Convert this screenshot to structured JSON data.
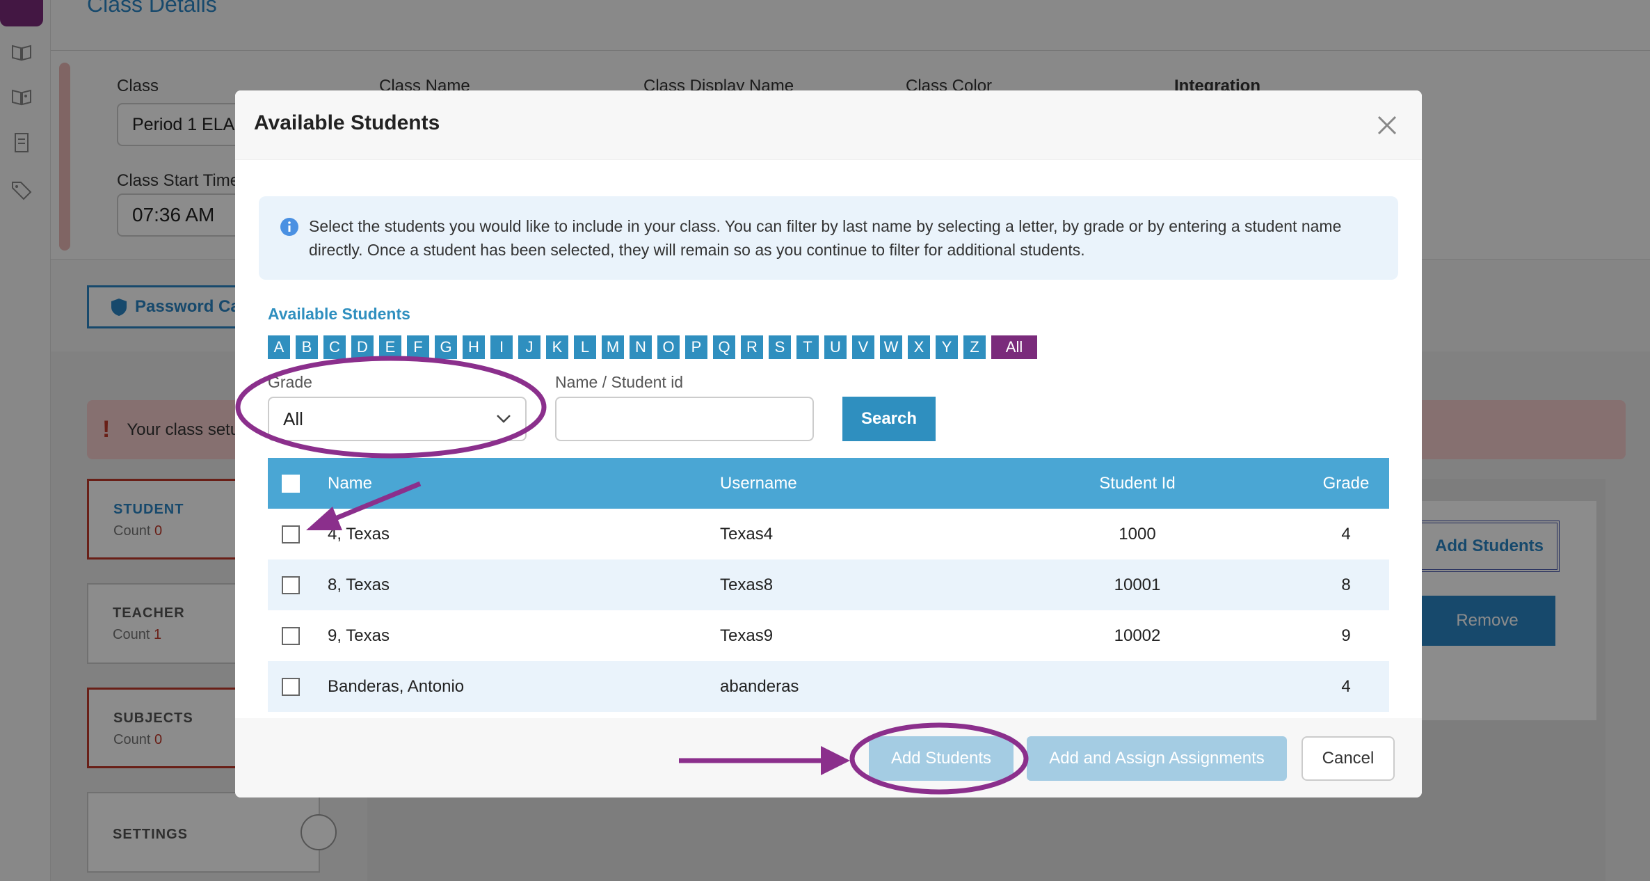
{
  "background": {
    "page_title": "Class Details",
    "fields": {
      "class_label": "Class",
      "class_value": "Period 1 ELA",
      "class_name_label": "Class Name",
      "display_name_label": "Class Display Name",
      "class_color_label": "Class Color",
      "integration_label": "Integration",
      "start_time_label": "Class Start Time",
      "start_time_value": "07:36 AM"
    },
    "password_button": "Password Ca",
    "alert_text": "Your class setu",
    "cards": [
      {
        "title": "STUDENT",
        "count_label": "Count",
        "count": "0"
      },
      {
        "title": "TEACHER",
        "count_label": "Count",
        "count": "1"
      },
      {
        "title": "SUBJECTS",
        "count_label": "Count",
        "count": "0"
      },
      {
        "title": "SETTINGS"
      }
    ],
    "add_students_button": "Add Students",
    "remove_button": "Remove"
  },
  "modal": {
    "title": "Available Students",
    "info_text": "Select the students you would like to include in your class. You can filter by last name by selecting a letter, by grade or by entering a student name directly. Once a student has been selected, they will remain so as you continue to filter for additional students.",
    "available_label": "Available Students",
    "letters": [
      "A",
      "B",
      "C",
      "D",
      "E",
      "F",
      "G",
      "H",
      "I",
      "J",
      "K",
      "L",
      "M",
      "N",
      "O",
      "P",
      "Q",
      "R",
      "S",
      "T",
      "U",
      "V",
      "W",
      "X",
      "Y",
      "Z"
    ],
    "all_label": "All",
    "grade_label": "Grade",
    "grade_value": "All",
    "name_label": "Name / Student id",
    "name_value": "",
    "search_label": "Search",
    "table": {
      "headers": {
        "name": "Name",
        "username": "Username",
        "student_id": "Student Id",
        "grade": "Grade"
      },
      "rows": [
        {
          "name": "4, Texas",
          "username": "Texas4",
          "student_id": "1000",
          "grade": "4"
        },
        {
          "name": "8, Texas",
          "username": "Texas8",
          "student_id": "10001",
          "grade": "8"
        },
        {
          "name": "9, Texas",
          "username": "Texas9",
          "student_id": "10002",
          "grade": "9"
        },
        {
          "name": "Banderas, Antonio",
          "username": "abanderas",
          "student_id": "",
          "grade": "4"
        }
      ]
    },
    "footer": {
      "add_students": "Add Students",
      "add_assign": "Add and Assign Assignments",
      "cancel": "Cancel"
    }
  },
  "colors": {
    "accent_blue": "#2f8fbf",
    "header_blue": "#4aa6d4",
    "purple": "#7a2b7b",
    "annotation_purple": "#8b2f8c"
  }
}
